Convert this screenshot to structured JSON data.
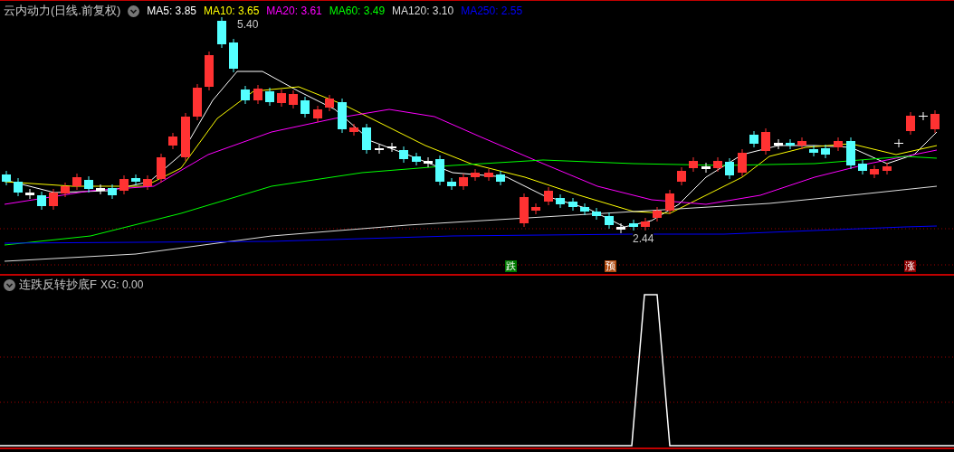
{
  "main_panel": {
    "title": "云内动力(日线.前复权)",
    "indicators": [
      {
        "label": "MA5: 3.85",
        "color": "#ffffff"
      },
      {
        "label": "MA10: 3.65",
        "color": "#ffff00"
      },
      {
        "label": "MA20: 3.61",
        "color": "#ff00ff"
      },
      {
        "label": "MA60: 3.49",
        "color": "#00ff00"
      },
      {
        "label": "MA120: 3.10",
        "color": "#dddddd"
      },
      {
        "label": "MA250: 2.55",
        "color": "#0000ff"
      }
    ],
    "price_labels": [
      {
        "text": "5.40"
      },
      {
        "text": "2.44"
      }
    ],
    "signals": [
      {
        "text": "跌",
        "color": "#007a00"
      },
      {
        "text": "预",
        "color": "#b04a10"
      },
      {
        "text": "涨",
        "color": "#8b0000"
      }
    ]
  },
  "sub_panel": {
    "title": "连跌反转抄底F",
    "reading": "XG: 0.00"
  }
}
